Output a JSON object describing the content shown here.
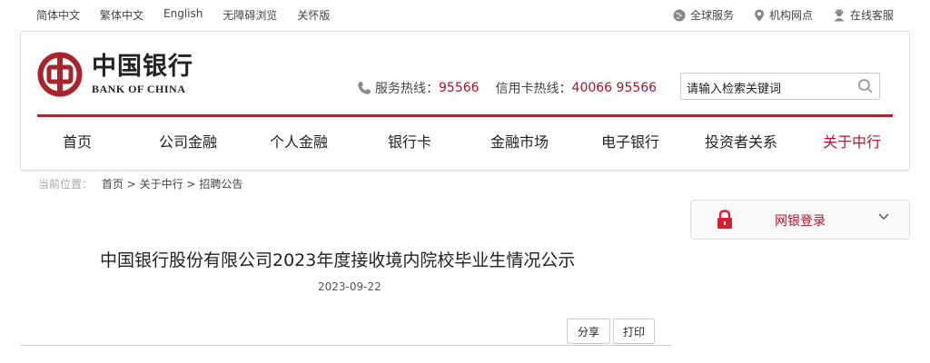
{
  "topbar": {
    "lang_simplified": "简体中文",
    "lang_traditional": "繁体中文",
    "lang_english": "English",
    "accessible": "无障碍浏览",
    "care": "关怀版",
    "global_service": "全球服务",
    "branches": "机构网点",
    "online_service": "在线客服"
  },
  "logo": {
    "cn": "中国银行",
    "en": "BANK OF CHINA"
  },
  "hotline": {
    "service_label": "服务热线：",
    "service_number": "95566",
    "card_label": "信用卡热线：",
    "card_number": "40066 95566"
  },
  "search": {
    "placeholder": "请输入检索关键词"
  },
  "nav": {
    "items": [
      "首页",
      "公司金融",
      "个人金融",
      "银行卡",
      "金融市场",
      "电子银行",
      "投资者关系",
      "关于中行"
    ]
  },
  "breadcrumb": {
    "label": "当前位置：",
    "home": "首页",
    "sep": ">",
    "about": "关于中行",
    "current": "招聘公告"
  },
  "login": {
    "label": "网银登录"
  },
  "article": {
    "title": "中国银行股份有限公司2023年度接收境内院校毕业生情况公示",
    "date": "2023-09-22",
    "share": "分享",
    "print": "打印"
  },
  "colors": {
    "brand_red": "#a8242f",
    "accent_red": "#c0102b"
  }
}
